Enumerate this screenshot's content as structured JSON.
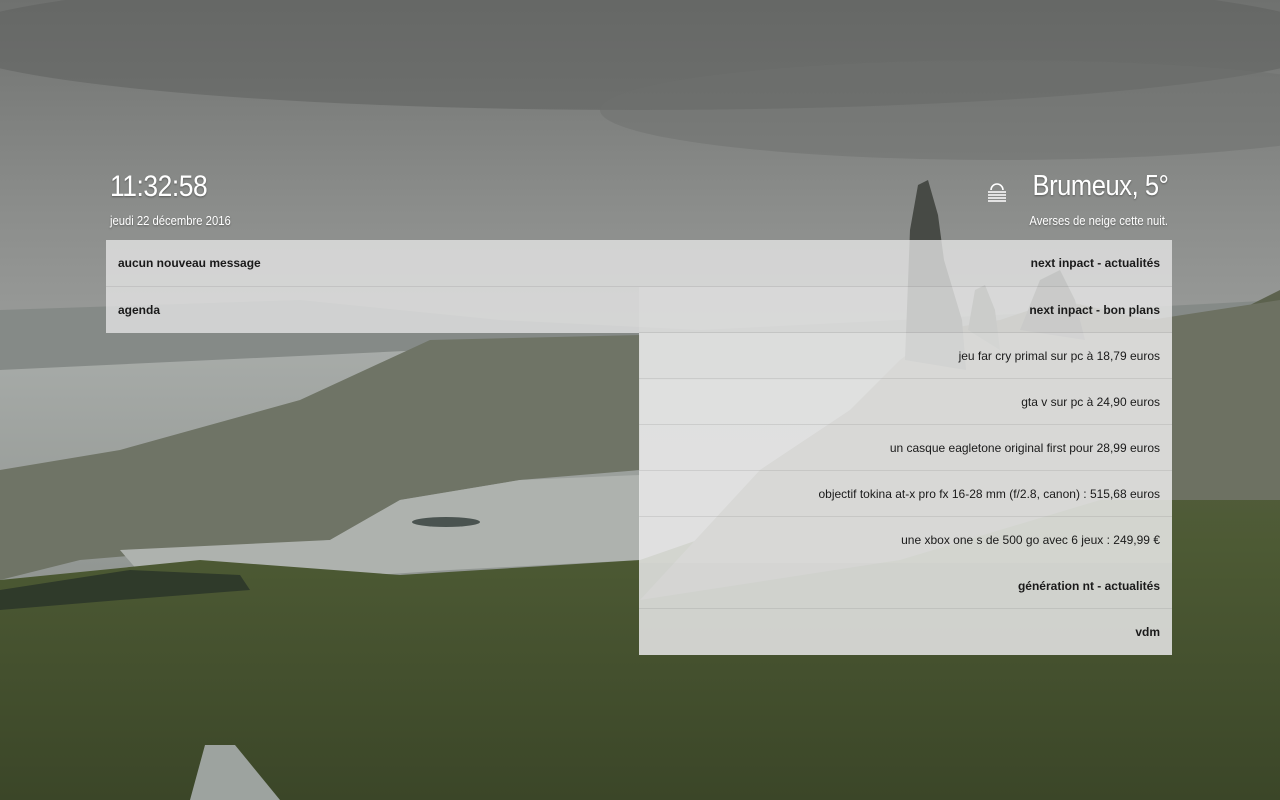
{
  "clock": {
    "time": "11:32:58",
    "date": "jeudi 22 décembre 2016"
  },
  "weather": {
    "icon": "fog-icon",
    "summary": "Brumeux, 5°",
    "forecast": "Averses de neige cette nuit."
  },
  "panels": {
    "messages": "aucun nouveau message",
    "agenda": "agenda"
  },
  "feeds": {
    "nextinpact_news": "next inpact - actualités",
    "nextinpact_deals": "next inpact - bon plans",
    "deals": [
      "jeu far cry primal sur pc à 18,79 euros",
      "gta v sur pc à 24,90 euros",
      "un casque eagletone original first pour 28,99 euros",
      "objectif tokina at-x pro fx 16-28 mm (f/2.8, canon) : 515,68 euros",
      "une xbox one s de 500 go avec 6 jeux : 249,99 €"
    ],
    "generation_nt": "génération nt - actualités",
    "vdm": "vdm"
  },
  "colors": {
    "text_light": "#ffffff",
    "text_dark": "#1a1a1a",
    "panel_bg": "#e6e6e6"
  }
}
